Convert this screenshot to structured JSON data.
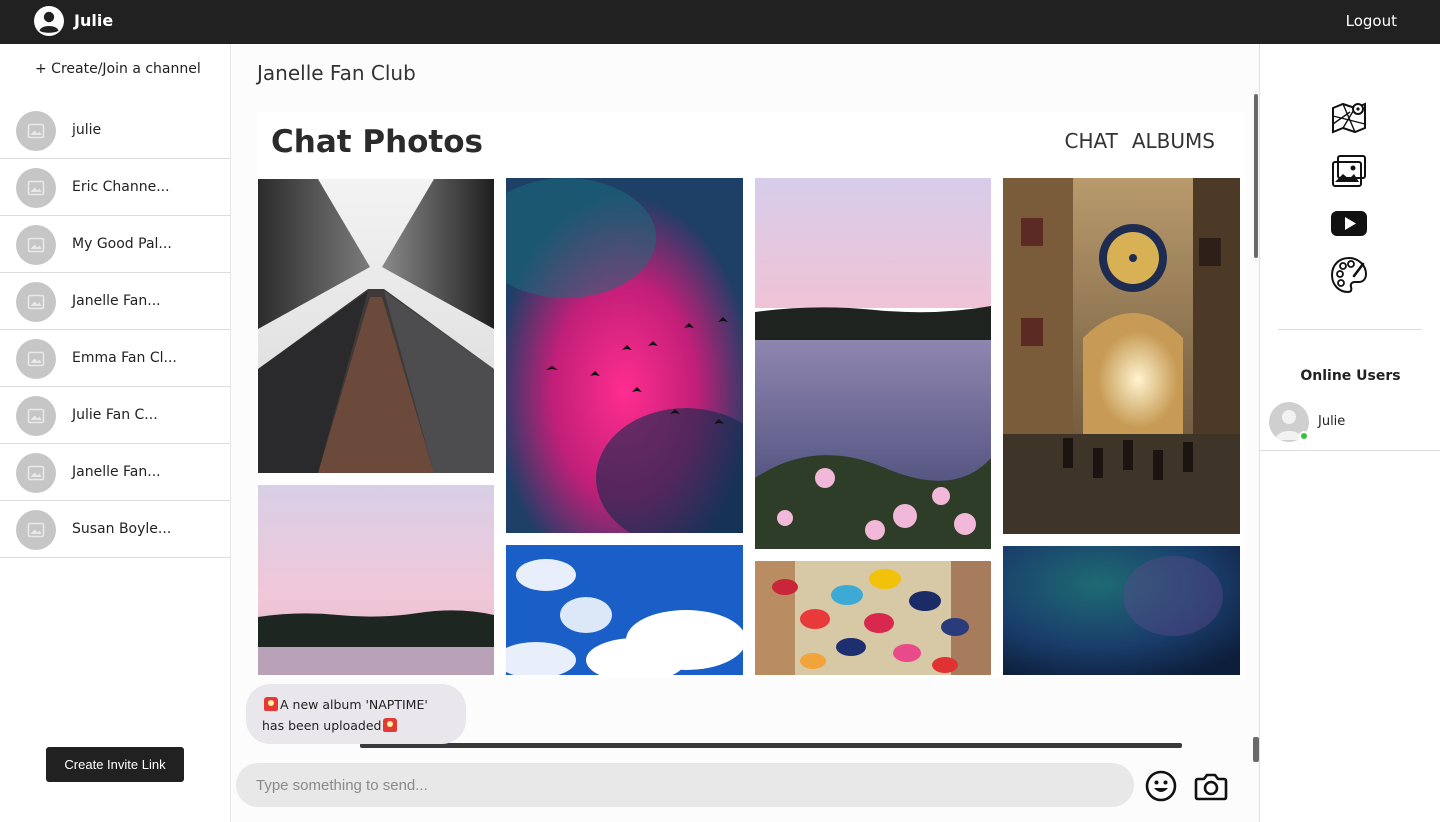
{
  "topbar": {
    "user_name": "Julie",
    "logout_label": "Logout",
    "avatar_icon": "user-circle-icon"
  },
  "sidebar": {
    "create_join_label": "+ Create/Join a channel",
    "channels": [
      {
        "name": "julie"
      },
      {
        "name": "Eric Channe..."
      },
      {
        "name": "My Good Pal..."
      },
      {
        "name": "Janelle Fan..."
      },
      {
        "name": "Emma Fan Cl..."
      },
      {
        "name": "Julie Fan C..."
      },
      {
        "name": "Janelle Fan..."
      },
      {
        "name": "Susan Boyle..."
      }
    ],
    "channel_avatar_icon": "image-placeholder-icon",
    "invite_button_label": "Create Invite Link"
  },
  "main": {
    "channel_title": "Janelle Fan Club",
    "photos_heading": "Chat Photos",
    "tabs": [
      {
        "label": "CHAT"
      },
      {
        "label": "ALBUMS"
      }
    ],
    "photos": [
      {
        "name": "skyscrapers-fog-photo"
      },
      {
        "name": "pink-cloud-birds-photo"
      },
      {
        "name": "lake-sunset-flowers-photo"
      },
      {
        "name": "clock-tower-street-photo"
      },
      {
        "name": "pink-sky-treeline-photo"
      },
      {
        "name": "blue-sky-clouds-photo"
      },
      {
        "name": "umbrellas-street-photo"
      },
      {
        "name": "dark-teal-abstract-photo"
      }
    ],
    "notice": {
      "line1": "A new album 'NAPTIME'",
      "line2": "has been uploaded",
      "icon": "siren-icon"
    },
    "composer": {
      "placeholder": "Type something to send...",
      "value": ""
    },
    "emoji_icon": "smiley-icon",
    "camera_icon": "camera-icon"
  },
  "rightpanel": {
    "icons": [
      "map-icon",
      "photo-album-icon",
      "youtube-play-icon",
      "palette-icon"
    ],
    "online_title": "Online Users",
    "online_users": [
      {
        "name": "Julie",
        "status": "online",
        "status_color": "#3cc13b"
      }
    ]
  },
  "colors": {
    "topbar_bg": "#212121",
    "accent_online": "#3cc13b",
    "composer_bg": "#e8e8e8",
    "notice_bg": "#e9e7ec"
  }
}
